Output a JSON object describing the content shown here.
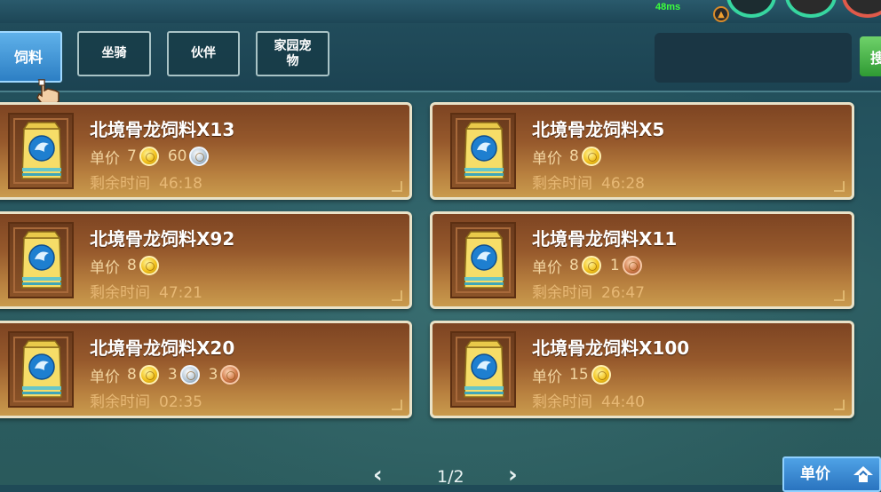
{
  "status": {
    "ping": "48ms"
  },
  "tabs": [
    {
      "label": "饲料",
      "active": true
    },
    {
      "label": "坐骑",
      "active": false
    },
    {
      "label": "伙伴",
      "active": false
    },
    {
      "label": "家园宠物",
      "active": false
    }
  ],
  "search": {
    "button_label": "搜"
  },
  "listings": [
    {
      "name": "北境骨龙饲料X13",
      "price_label": "单价",
      "gold": "7",
      "silver": "60",
      "copper": "",
      "time_label": "剩余时间",
      "time": "46:18"
    },
    {
      "name": "北境骨龙饲料X5",
      "price_label": "单价",
      "gold": "8",
      "silver": "",
      "copper": "",
      "time_label": "剩余时间",
      "time": "46:28"
    },
    {
      "name": "北境骨龙饲料X92",
      "price_label": "单价",
      "gold": "8",
      "silver": "",
      "copper": "",
      "time_label": "剩余时间",
      "time": "47:21"
    },
    {
      "name": "北境骨龙饲料X11",
      "price_label": "单价",
      "gold": "8",
      "silver": "",
      "copper": "1",
      "time_label": "剩余时间",
      "time": "26:47"
    },
    {
      "name": "北境骨龙饲料X20",
      "price_label": "单价",
      "gold": "8",
      "silver": "3",
      "copper": "3",
      "time_label": "剩余时间",
      "time": "02:35"
    },
    {
      "name": "北境骨龙饲料X100",
      "price_label": "单价",
      "gold": "15",
      "silver": "",
      "copper": "",
      "time_label": "剩余时间",
      "time": "44:40"
    }
  ],
  "pagination": {
    "page": "1/2"
  },
  "sort": {
    "label": "单价"
  },
  "colors": {
    "gold": "#f2c21c",
    "silver": "#b7c8d6",
    "copper": "#d07b4a",
    "card_top": "#7d4422",
    "card_bottom": "#c99a4d",
    "active_tab": "#2d7fc4"
  },
  "icons": {
    "item": "feed-bag-icon",
    "coin_gold": "gold-coin-icon",
    "coin_silver": "silver-coin-icon",
    "coin_copper": "copper-coin-icon"
  }
}
